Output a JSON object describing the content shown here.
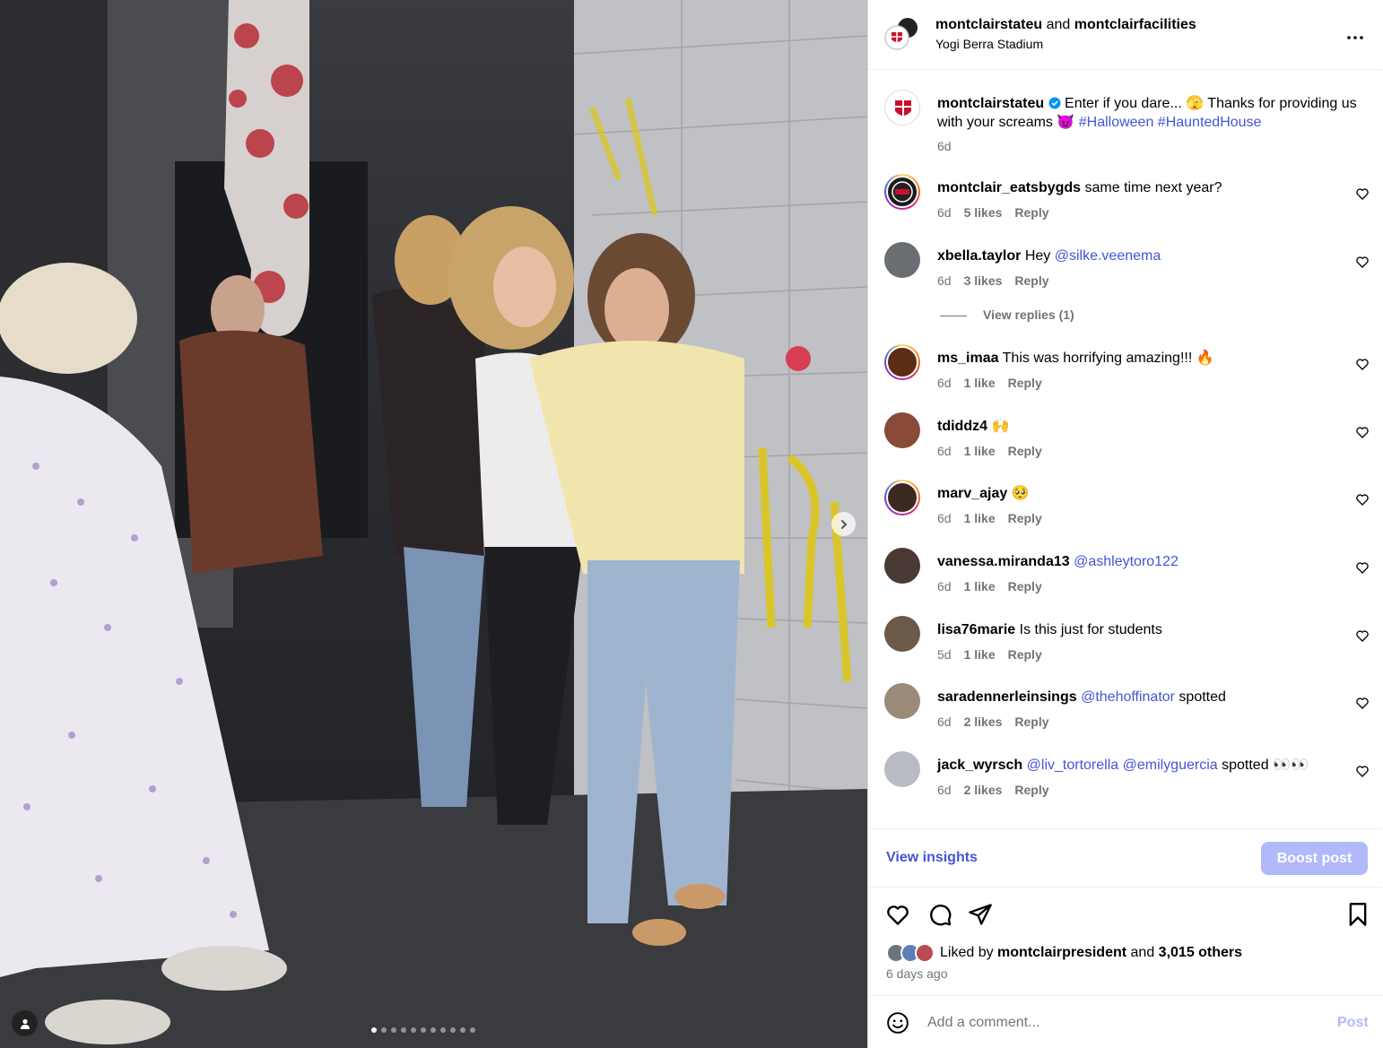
{
  "header": {
    "user1": "montclairstateu",
    "joiner": " and ",
    "user2": "montclairfacilities",
    "location": "Yogi Berra Stadium"
  },
  "caption": {
    "user": "montclairstateu",
    "verified": true,
    "text_before": " Enter if you dare... 🫣 Thanks for providing us with your screams 😈 ",
    "hashtags": [
      "#Halloween",
      "#HauntedHouse"
    ],
    "time": "6d"
  },
  "comments": [
    {
      "user": "montclair_eatsbygds",
      "text": " same time next year?",
      "time": "6d",
      "likes": "5 likes",
      "reply": "Reply"
    },
    {
      "user": "xbella.taylor",
      "text": " Hey ",
      "mention": "@silke.veenema",
      "time": "6d",
      "likes": "3 likes",
      "reply": "Reply",
      "view_replies": "View replies (1)"
    },
    {
      "user": "ms_imaa",
      "text": " This was horrifying amazing!!! 🔥",
      "time": "6d",
      "likes": "1 like",
      "reply": "Reply"
    },
    {
      "user": "tdiddz4",
      "text": " 🙌",
      "time": "6d",
      "likes": "1 like",
      "reply": "Reply"
    },
    {
      "user": "marv_ajay",
      "text": " 🥺",
      "time": "6d",
      "likes": "1 like",
      "reply": "Reply"
    },
    {
      "user": "vanessa.miranda13",
      "text": " ",
      "mention": "@ashleytoro122",
      "time": "6d",
      "likes": "1 like",
      "reply": "Reply"
    },
    {
      "user": "lisa76marie",
      "text": " Is this just for students",
      "time": "5d",
      "likes": "1 like",
      "reply": "Reply"
    },
    {
      "user": "saradennerleinsings",
      "text": " ",
      "mention": "@thehoffinator",
      "after": " spotted",
      "time": "6d",
      "likes": "2 likes",
      "reply": "Reply"
    },
    {
      "user": "jack_wyrsch",
      "text": " ",
      "mention": "@liv_tortorella",
      "mention2": "@emilyguercia",
      "after": " spotted 👀👀",
      "time": "6d",
      "likes": "2 likes",
      "reply": "Reply"
    }
  ],
  "insights": {
    "view_label": "View insights",
    "boost_label": "Boost post"
  },
  "likes": {
    "prefix": "Liked by ",
    "user": "montclairpresident",
    "mid": " and ",
    "count": "3,015 others"
  },
  "posted_ago": "6 days ago",
  "comment_box": {
    "placeholder": "Add a comment...",
    "post_label": "Post"
  },
  "carousel": {
    "total": 11,
    "current": 1
  },
  "colors": {
    "link": "#4355d6",
    "boost_bg": "#b2b9fb",
    "muted": "#737373"
  }
}
